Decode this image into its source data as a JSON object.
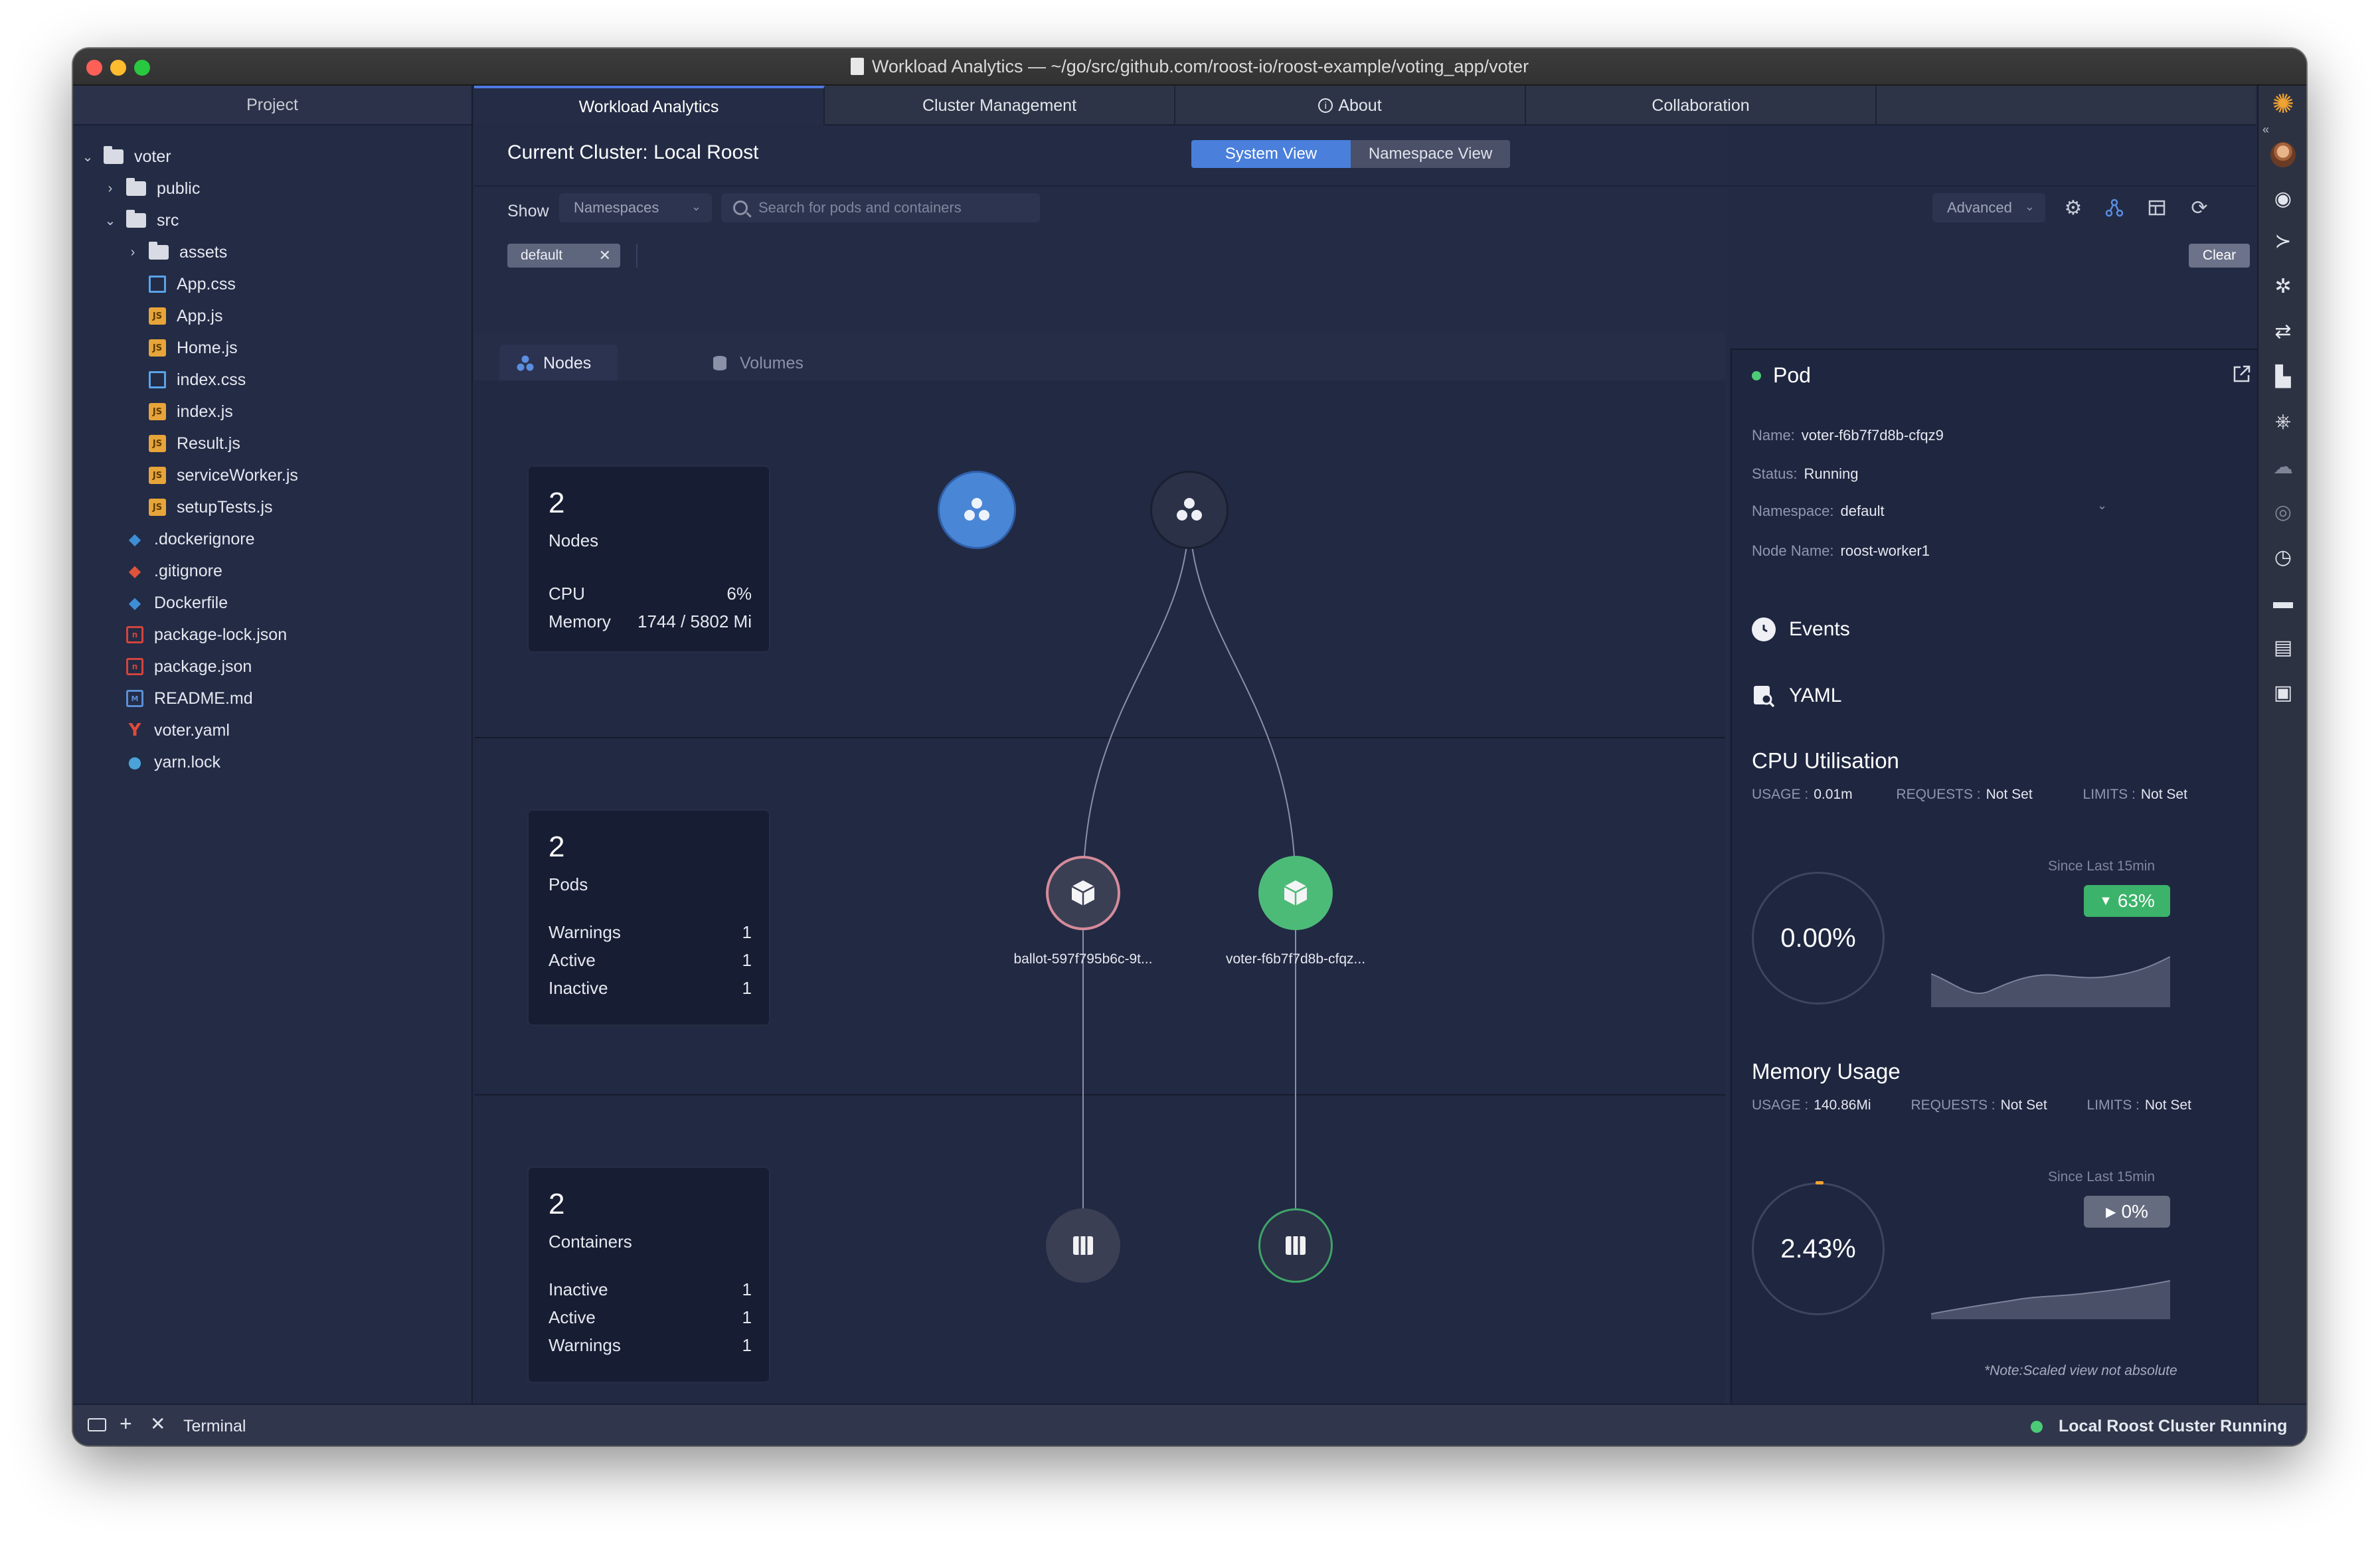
{
  "window": {
    "title": "Workload Analytics — ~/go/src/github.com/roost-io/roost-example/voting_app/voter"
  },
  "sidebar": {
    "header": "Project",
    "items": [
      {
        "label": "voter",
        "kind": "folder",
        "icon": "folder-icon"
      },
      {
        "label": "public",
        "kind": "folder",
        "icon": "folder-icon"
      },
      {
        "label": "src",
        "kind": "folder",
        "icon": "folder-icon"
      },
      {
        "label": "assets",
        "kind": "folder",
        "icon": "folder-icon"
      },
      {
        "label": "App.css",
        "kind": "css",
        "icon": "css-file-icon"
      },
      {
        "label": "App.js",
        "kind": "js",
        "icon": "js-file-icon"
      },
      {
        "label": "Home.js",
        "kind": "js",
        "icon": "js-file-icon"
      },
      {
        "label": "index.css",
        "kind": "css",
        "icon": "css-file-icon"
      },
      {
        "label": "index.js",
        "kind": "js",
        "icon": "js-file-icon"
      },
      {
        "label": "Result.js",
        "kind": "js",
        "icon": "js-file-icon"
      },
      {
        "label": "serviceWorker.js",
        "kind": "js",
        "icon": "js-file-icon"
      },
      {
        "label": "setupTests.js",
        "kind": "js",
        "icon": "js-file-icon"
      },
      {
        "label": ".dockerignore",
        "kind": "docker",
        "icon": "docker-icon"
      },
      {
        "label": ".gitignore",
        "kind": "git",
        "icon": "git-icon"
      },
      {
        "label": "Dockerfile",
        "kind": "docker",
        "icon": "docker-icon"
      },
      {
        "label": "package-lock.json",
        "kind": "json",
        "icon": "npm-icon"
      },
      {
        "label": "package.json",
        "kind": "json",
        "icon": "npm-icon"
      },
      {
        "label": "README.md",
        "kind": "md",
        "icon": "markdown-icon"
      },
      {
        "label": "voter.yaml",
        "kind": "yaml",
        "icon": "yaml-icon"
      },
      {
        "label": "yarn.lock",
        "kind": "yarn",
        "icon": "yarn-icon"
      }
    ]
  },
  "tabs": [
    {
      "label": "Workload Analytics",
      "active": true
    },
    {
      "label": "Cluster Management",
      "active": false
    },
    {
      "label": "About",
      "active": false,
      "icon": "info-icon"
    },
    {
      "label": "Collaboration",
      "active": false
    }
  ],
  "main": {
    "cluster_title": "Current Cluster: Local Roost",
    "view_toggle": {
      "system": "System View",
      "namespace": "Namespace View",
      "selected": "System View"
    },
    "show_label": "Show",
    "show_select": "Namespaces",
    "search_placeholder": "Search for pods and containers",
    "advanced_select": "Advanced",
    "filter_chip": "default",
    "clear_label": "Clear",
    "subtabs": {
      "nodes": "Nodes",
      "volumes": "Volumes"
    }
  },
  "stats": {
    "nodes": {
      "count": "2",
      "title": "Nodes",
      "rows": [
        {
          "label": "CPU",
          "value": "6%"
        },
        {
          "label": "Memory",
          "value": "1744 / 5802 Mi"
        }
      ]
    },
    "pods": {
      "count": "2",
      "title": "Pods",
      "rows": [
        {
          "label": "Warnings",
          "value": "1"
        },
        {
          "label": "Active",
          "value": "1"
        },
        {
          "label": "Inactive",
          "value": "1"
        }
      ]
    },
    "containers": {
      "count": "2",
      "title": "Containers",
      "rows": [
        {
          "label": "Inactive",
          "value": "1"
        },
        {
          "label": "Active",
          "value": "1"
        },
        {
          "label": "Warnings",
          "value": "1"
        }
      ]
    }
  },
  "graph": {
    "pod_labels": {
      "ballot": "ballot-597f795b6c-9t...",
      "voter": "voter-f6b7f7d8b-cfqz..."
    },
    "colors": {
      "blue": "#4a86d6",
      "green": "#4dbb78",
      "pink": "#d58b9a",
      "dark": "#2b3147"
    }
  },
  "pod": {
    "title": "Pod",
    "name_label": "Name:",
    "name": "voter-f6b7f7d8b-cfqz9",
    "status_label": "Status:",
    "status": "Running",
    "namespace_label": "Namespace:",
    "namespace": "default",
    "node_label": "Node Name:",
    "node": "roost-worker1",
    "events": "Events",
    "yaml": "YAML",
    "cpu": {
      "title": "CPU Utilisation",
      "usage_label": "USAGE :",
      "usage": "0.01m",
      "requests_label": "REQUESTS :",
      "requests": "Not Set",
      "limits_label": "LIMITS :",
      "limits": "Not Set",
      "gauge": "0.00%",
      "since": "Since Last 15min",
      "badge": "63%"
    },
    "memory": {
      "title": "Memory Usage",
      "usage_label": "USAGE :",
      "usage": "140.86Mi",
      "requests_label": "REQUESTS :",
      "requests": "Not Set",
      "limits_label": "LIMITS :",
      "limits": "Not Set",
      "gauge": "2.43%",
      "since": "Since Last 15min",
      "badge": "0%"
    },
    "note": "*Note:Scaled view not absolute"
  },
  "statusbar": {
    "terminal": "Terminal",
    "cluster_status": "Local Roost Cluster Running"
  }
}
